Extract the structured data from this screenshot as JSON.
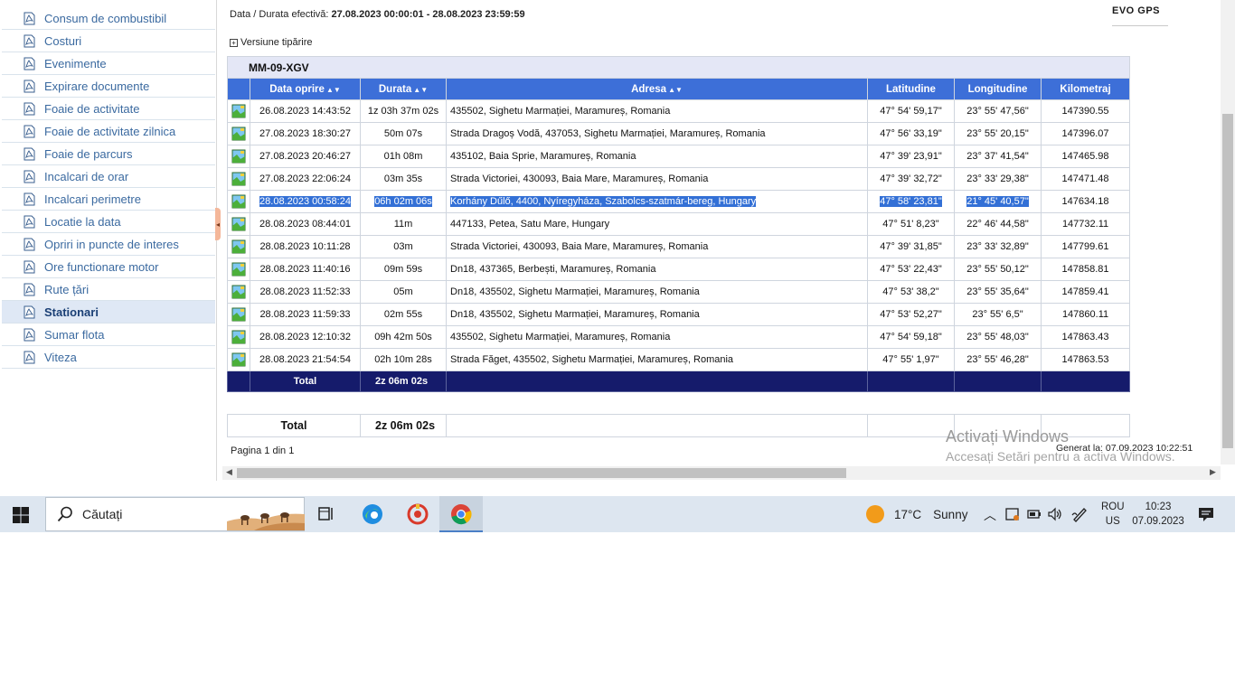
{
  "sidebar": {
    "items": [
      {
        "label": "Consum de combustibil"
      },
      {
        "label": "Costuri"
      },
      {
        "label": "Evenimente"
      },
      {
        "label": "Expirare documente"
      },
      {
        "label": "Foaie de activitate"
      },
      {
        "label": "Foaie de activitate zilnica"
      },
      {
        "label": "Foaie de parcurs"
      },
      {
        "label": "Incalcari de orar"
      },
      {
        "label": "Incalcari perimetre"
      },
      {
        "label": "Locatie la data"
      },
      {
        "label": "Opriri in puncte de interes"
      },
      {
        "label": "Ore functionare motor"
      },
      {
        "label": "Rute țări"
      },
      {
        "label": "Stationari"
      },
      {
        "label": "Sumar flota"
      },
      {
        "label": "Viteza"
      }
    ],
    "active_index": 13
  },
  "report": {
    "period_label": "Data / Durata efectivă:",
    "period_value": "27.08.2023 00:00:01 - 28.08.2023 23:59:59",
    "logo": "EVO GPS",
    "print_version": "Versiune tipărire",
    "vehicle": "MM-09-XGV",
    "columns": {
      "date": "Data oprire",
      "duration": "Durata",
      "address": "Adresa",
      "lat": "Latitudine",
      "lon": "Longitudine",
      "km": "Kilometraj"
    },
    "rows": [
      {
        "date": "26.08.2023 14:43:52",
        "duration": "1z 03h 37m 02s",
        "address": "435502, Sighetu Marmației, Maramureș, Romania",
        "lat": "47° 54' 59,17\"",
        "lon": "23° 55' 47,56\"",
        "km": "147390.55"
      },
      {
        "date": "27.08.2023 18:30:27",
        "duration": "50m 07s",
        "address": "Strada Dragoș Vodă,  437053, Sighetu Marmației, Maramureș, Romania",
        "lat": "47° 56' 33,19\"",
        "lon": "23° 55' 20,15\"",
        "km": "147396.07"
      },
      {
        "date": "27.08.2023 20:46:27",
        "duration": "01h 08m",
        "address": "435102, Baia Sprie, Maramureș, Romania",
        "lat": "47° 39' 23,91\"",
        "lon": "23° 37' 41,54\"",
        "km": "147465.98"
      },
      {
        "date": "27.08.2023 22:06:24",
        "duration": "03m 35s",
        "address": "Strada Victoriei,  430093, Baia Mare, Maramureș, Romania",
        "lat": "47° 39' 32,72\"",
        "lon": "23° 33' 29,38\"",
        "km": "147471.48"
      },
      {
        "date": "28.08.2023 00:58:24",
        "duration": "06h 02m 06s",
        "address": "Korhány Dűlő,  4400, Nyíregyháza, Szabolcs-szatmár-bereg, Hungary",
        "lat": "47° 58' 23,81\"",
        "lon": "21° 45' 40,57\"",
        "km": "147634.18"
      },
      {
        "date": "28.08.2023 08:44:01",
        "duration": "11m",
        "address": "447133, Petea, Satu Mare, Hungary",
        "lat": "47° 51' 8,23\"",
        "lon": "22° 46' 44,58\"",
        "km": "147732.11"
      },
      {
        "date": "28.08.2023 10:11:28",
        "duration": "03m",
        "address": "Strada Victoriei,  430093, Baia Mare, Maramureș, Romania",
        "lat": "47° 39' 31,85\"",
        "lon": "23° 33' 32,89\"",
        "km": "147799.61"
      },
      {
        "date": "28.08.2023 11:40:16",
        "duration": "09m 59s",
        "address": "Dn18,  437365, Berbești, Maramureș, Romania",
        "lat": "47° 53' 22,43\"",
        "lon": "23° 55' 50,12\"",
        "km": "147858.81"
      },
      {
        "date": "28.08.2023 11:52:33",
        "duration": "05m",
        "address": "Dn18,  435502, Sighetu Marmației, Maramureș, Romania",
        "lat": "47° 53' 38,2\"",
        "lon": "23° 55' 35,64\"",
        "km": "147859.41"
      },
      {
        "date": "28.08.2023 11:59:33",
        "duration": "02m 55s",
        "address": "Dn18,  435502, Sighetu Marmației, Maramureș, Romania",
        "lat": "47° 53' 52,27\"",
        "lon": "23° 55' 6,5\"",
        "km": "147860.11"
      },
      {
        "date": "28.08.2023 12:10:32",
        "duration": "09h 42m 50s",
        "address": "435502, Sighetu Marmației, Maramureș, Romania",
        "lat": "47° 54' 59,18\"",
        "lon": "23° 55' 48,03\"",
        "km": "147863.43"
      },
      {
        "date": "28.08.2023 21:54:54",
        "duration": "02h 10m 28s",
        "address": "Strada Făget,  435502, Sighetu Marmației, Maramureș, Romania",
        "lat": "47° 55' 1,97\"",
        "lon": "23° 55' 46,28\"",
        "km": "147863.53"
      }
    ],
    "selected_row": 4,
    "total_label": "Total",
    "total_value": "2z 06m 02s",
    "grand_total_label": "Total",
    "grand_total_value": "2z 06m 02s",
    "page_info": "Pagina 1 din 1",
    "generated": "Generat la: 07.09.2023 10:22:51",
    "watermark_title": "Activați Windows",
    "watermark_sub": "Accesați Setări pentru a activa Windows."
  },
  "taskbar": {
    "search_placeholder": "Căutați",
    "weather_temp": "17°C",
    "weather_desc": "Sunny",
    "lang_top": "ROU",
    "lang_bottom": "US",
    "time": "10:23",
    "date": "07.09.2023"
  },
  "colors": {
    "header_blue": "#3d6fd8",
    "total_navy": "#151b6b",
    "selection_blue": "#3370d6",
    "sidebar_link": "#3b6aa0"
  }
}
